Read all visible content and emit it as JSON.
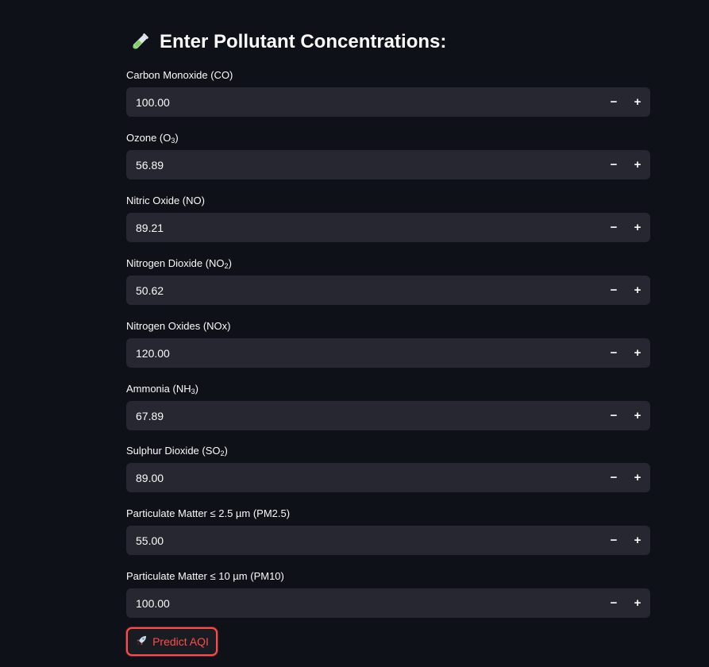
{
  "heading": {
    "emoji": "test-tube-icon",
    "text": "Enter Pollutant Concentrations:"
  },
  "fields": [
    {
      "label_pre": "Carbon Monoxide (CO)",
      "label_sub": "",
      "label_post": "",
      "value": "100.00"
    },
    {
      "label_pre": "Ozone (O",
      "label_sub": "3",
      "label_post": ")",
      "value": "56.89"
    },
    {
      "label_pre": "Nitric Oxide (NO)",
      "label_sub": "",
      "label_post": "",
      "value": "89.21"
    },
    {
      "label_pre": "Nitrogen Dioxide (NO",
      "label_sub": "2",
      "label_post": ")",
      "value": "50.62"
    },
    {
      "label_pre": "Nitrogen Oxides (NOx)",
      "label_sub": "",
      "label_post": "",
      "value": "120.00"
    },
    {
      "label_pre": "Ammonia (NH",
      "label_sub": "3",
      "label_post": ")",
      "value": "67.89"
    },
    {
      "label_pre": "Sulphur Dioxide (SO",
      "label_sub": "2",
      "label_post": ")",
      "value": "89.00"
    },
    {
      "label_pre": "Particulate Matter ≤ 2.5 µm (PM2.5)",
      "label_sub": "",
      "label_post": "",
      "value": "55.00"
    },
    {
      "label_pre": "Particulate Matter ≤ 10 µm (PM10)",
      "label_sub": "",
      "label_post": "",
      "value": "100.00"
    }
  ],
  "stepper": {
    "minus": "−",
    "plus": "+"
  },
  "predict_button": {
    "icon": "rocket-icon",
    "label": "Predict AQI"
  },
  "colors": {
    "background": "#0e1117",
    "input_bg": "#262730",
    "accent": "#ff4b4b"
  }
}
